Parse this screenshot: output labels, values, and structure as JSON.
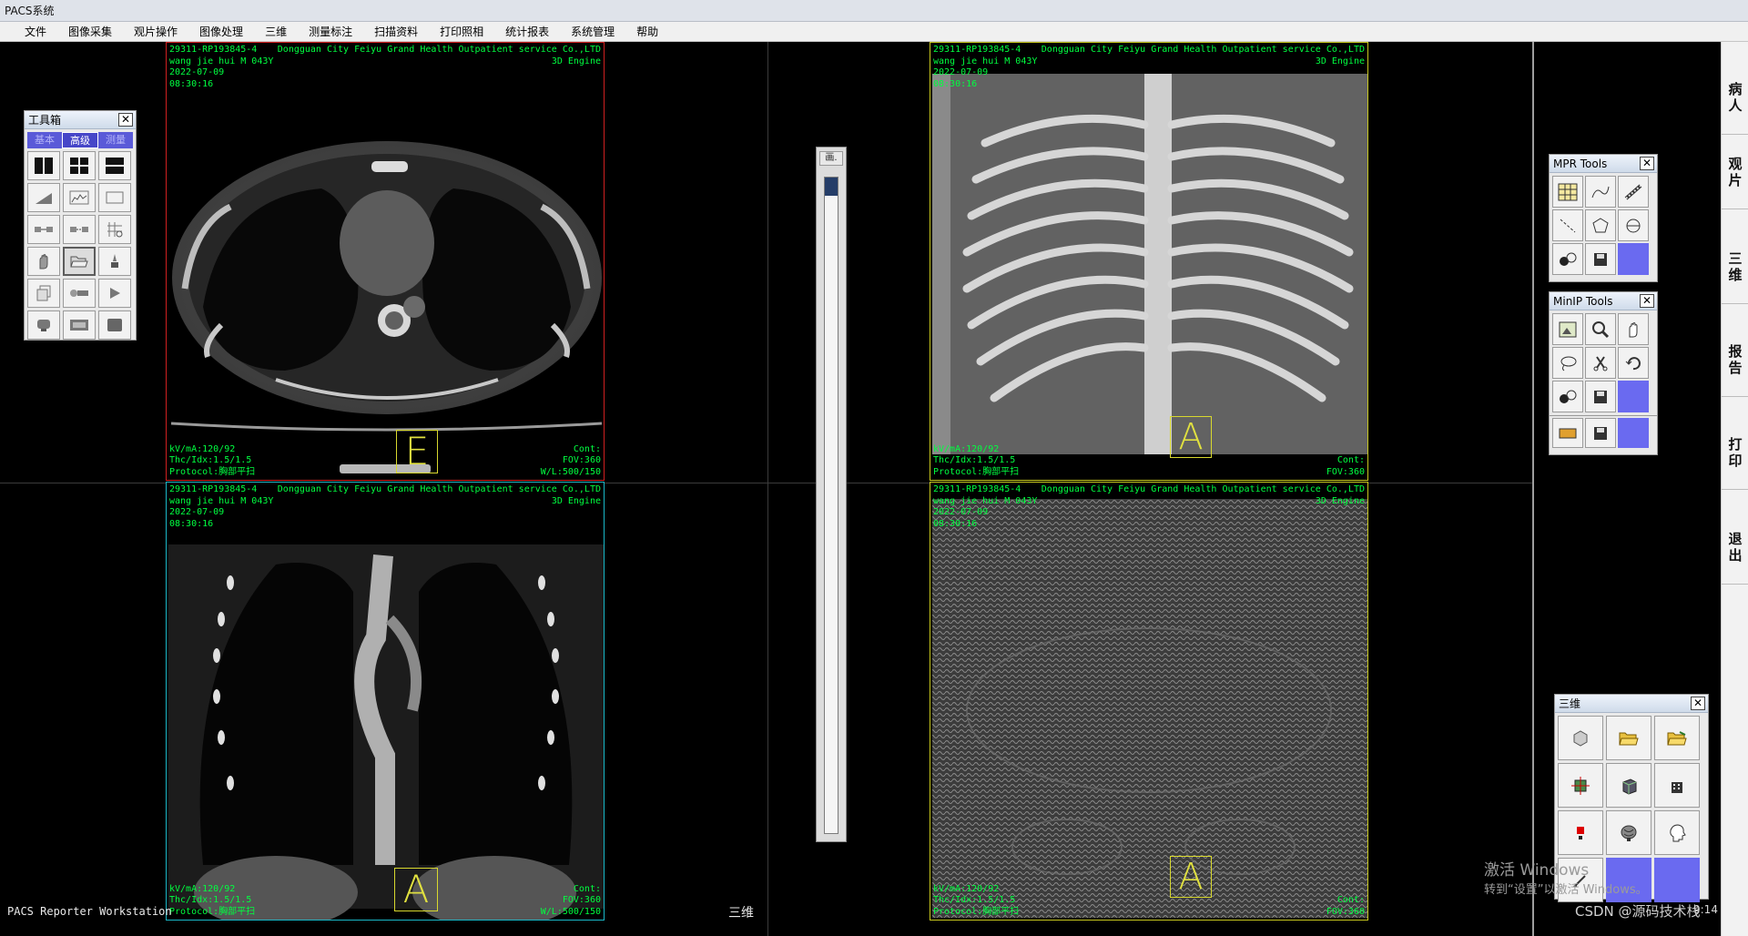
{
  "window": {
    "title": "PACS系统"
  },
  "menu": [
    "文件",
    "图像采集",
    "观片操作",
    "图像处理",
    "三维",
    "测量标注",
    "扫描资料",
    "打印照相",
    "统计报表",
    "系统管理",
    "帮助"
  ],
  "viewports": [
    {
      "id": "axial",
      "border_color": "#d02020",
      "tl": "29311-RP193845-4\nwang jie hui M 043Y\n2022-07-09\n08:30:16",
      "tr": "Dongguan City Feiyu Grand Health Outpatient service Co.,LTD\n3D Engine",
      "bl": "kV/mA:120/92\nThc/Idx:1.5/1.5\nProtocol:胸部平扫",
      "br": "Cont:\nFOV:360\nW/L:500/150",
      "orientation": "E"
    },
    {
      "id": "mip",
      "border_color": "#c8c81e",
      "tl": "29311-RP193845-4\nwang jie hui M 043Y\n2022-07-09\n08:30:16",
      "tr": "Dongguan City Feiyu Grand Health Outpatient service Co.,LTD\n3D Engine",
      "bl": "kV/mA:120/92\nThc/Idx:1.5/1.5\nProtocol:胸部平扫",
      "br": "Cont:\nFOV:360",
      "orientation": "A"
    },
    {
      "id": "coronal",
      "border_color": "#1ab8c8",
      "tl": "29311-RP193845-4\nwang jie hui M 043Y\n2022-07-09\n08:30:16",
      "tr": "Dongguan City Feiyu Grand Health Outpatient service Co.,LTD\n3D Engine",
      "bl": "kV/mA:120/92\nThc/Idx:1.5/1.5\nProtocol:胸部平扫",
      "br": "Cont:\nFOV:360\nW/L:500/150",
      "orientation": "A"
    },
    {
      "id": "minip",
      "border_color": "#c8c81e",
      "tl": "29311-RP193845-4\nwang jie hui M 043Y\n2022-07-09\n08:30:16",
      "tr": "Dongguan City Feiyu Grand Health Outpatient service Co.,LTD\n3D Engine",
      "bl": "kV/mA:120/92\nThc/Idx:1.5/1.5\nProtocol:胸部平扫",
      "br": "Cont:\nFOV:360",
      "orientation": "A"
    }
  ],
  "toolbox": {
    "title": "工具箱",
    "tabs": [
      "基本",
      "高级",
      "测量"
    ],
    "active_tab": "高级",
    "icons": [
      "layout-1x2-icon",
      "layout-2x2-icon",
      "layout-2x1-icon",
      "ramp-icon",
      "histogram-icon",
      "rect-roi-icon",
      "compare-icon",
      "link-series-icon",
      "grid-crop-icon",
      "hand-icon",
      "open-folder-icon",
      "brush-icon",
      "copy-icon",
      "cine-icon",
      "play-icon",
      "stamp-icon",
      "film-icon",
      "monitor-icon"
    ]
  },
  "mpr_tools": {
    "title": "MPR Tools",
    "icons": [
      "grid-icon",
      "curve-measure-icon",
      "ruler-icon",
      "slope-line-icon",
      "rotate-cube-icon",
      "rotate-3d-icon",
      "sphere-icon",
      "save-icon"
    ]
  },
  "minip_tools": {
    "title": "MinIP Tools",
    "icons": [
      "image-frame-icon",
      "zoom-icon",
      "pan-hand-icon",
      "lasso-icon",
      "scissors-icon",
      "undo-icon",
      "sphere-icon",
      "save-icon"
    ],
    "extra_row": [
      "label-icon",
      "save-icon"
    ]
  },
  "vr_panel": {
    "title": "三维",
    "icons": [
      "volume-icon",
      "open-folder-icon",
      "open-folder-2-icon",
      "crosshair-cube-icon",
      "cube-icon",
      "building-icon",
      "marker-icon",
      "brain-icon",
      "head-icon",
      "pen-icon"
    ]
  },
  "right_rail": [
    "病\n人",
    "观\n片",
    "三\n维",
    "报\n告",
    "打\n印",
    "退\n出"
  ],
  "status": {
    "left": "PACS Reporter Workstation",
    "center": "三维",
    "time": "9:14"
  },
  "scroll_strip": {
    "header": "画."
  },
  "watermark": {
    "line1": "激活 Windows",
    "line2": "转到“设置”以激活 Windows。"
  },
  "csdn": "CSDN @源码技术栈",
  "colors": {
    "overlay_text": "#00ff40",
    "orientation_box": "#d8d82e",
    "palette_blank": "#6a6af0"
  }
}
